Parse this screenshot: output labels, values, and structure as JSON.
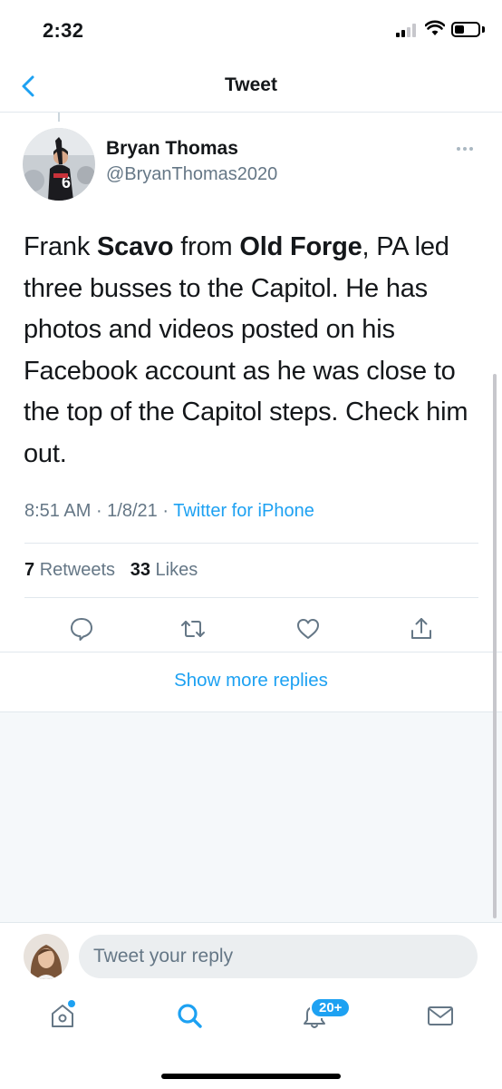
{
  "status_bar": {
    "time": "2:32",
    "signal_bars_filled": 2,
    "signal_bars_total": 4
  },
  "nav": {
    "title": "Tweet",
    "back_icon": "chevron-left-icon"
  },
  "tweet": {
    "author_name": "Bryan Thomas",
    "author_handle": "@BryanThomas2020",
    "text_parts": {
      "p1": "Frank ",
      "b1": "Scavo",
      "p2": " from ",
      "b2": "Old Forge",
      "p3": ", PA led three busses to the Capitol. He has photos and videos posted on his Facebook account as he was close to the top of the Capitol steps. Check him out."
    },
    "time": "8:51 AM",
    "date": "1/8/21",
    "separator": " · ",
    "source": "Twitter for iPhone",
    "retweets_count": "7",
    "retweets_label": "Retweets",
    "likes_count": "33",
    "likes_label": "Likes"
  },
  "actions": [
    {
      "name": "reply",
      "icon": "comment-icon"
    },
    {
      "name": "retweet",
      "icon": "retweet-icon"
    },
    {
      "name": "like",
      "icon": "heart-icon"
    },
    {
      "name": "share",
      "icon": "share-icon"
    }
  ],
  "show_more_replies": "Show more replies",
  "reply_bar": {
    "placeholder": "Tweet your reply"
  },
  "tab_bar": {
    "notifications_badge": "20+",
    "tabs": [
      "home-icon",
      "search-icon",
      "bell-icon",
      "mail-icon"
    ]
  },
  "colors": {
    "accent": "#1da1f2",
    "text": "#14171a",
    "secondary": "#657786",
    "divider": "#e1e8ed"
  }
}
